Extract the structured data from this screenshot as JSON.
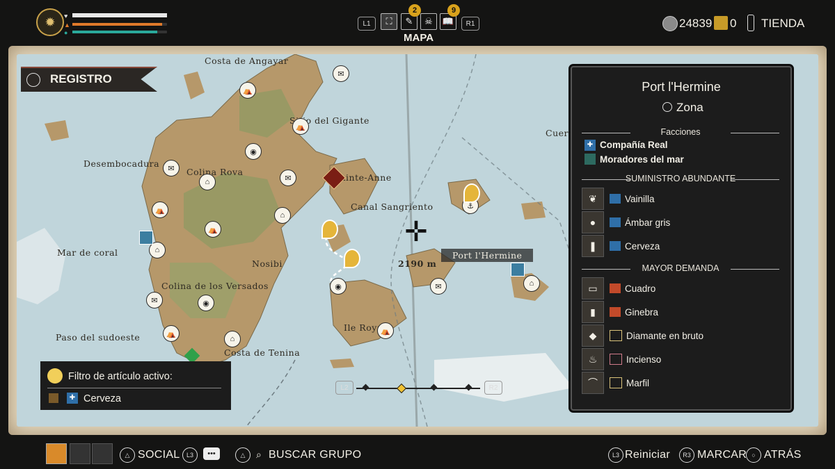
{
  "hud": {
    "mapa_label": "MAPA",
    "l1": "L1",
    "r1": "R1",
    "badge_1": "2",
    "badge_2": "9",
    "silver": "24839",
    "gold": "0",
    "tienda": "TIENDA",
    "health_level": 1.0,
    "stamina_level": 0.95,
    "xp_level": 0.9
  },
  "registro": {
    "label": "REGISTRO"
  },
  "map": {
    "labels": {
      "costa_angayar": "Costa de Angayar",
      "sitio_gigante": "Sitio del Gigante",
      "desembocadura": "Desembocadura",
      "colina_rova": "Colina Rova",
      "sainte_anne": "Sainte-Anne",
      "canal_sangriento": "Canal Sangriento",
      "mar_coral": "Mar de coral",
      "nosibi": "Nosibi",
      "colina_versados": "Colina de los Versados",
      "paso_sudoeste": "Paso del sudoeste",
      "costa_tenina": "Costa de Tenina",
      "ile_royale": "Ile Royale",
      "port_hermine": "Port l'Hermine",
      "cuer": "Cuer",
      "distance": "2190 m"
    },
    "l2": "L2",
    "r2": "R2"
  },
  "filter": {
    "title": "Filtro de artículo activo:",
    "item": "Cerveza"
  },
  "panel": {
    "title": "Port l'Hermine",
    "zona": "Zona",
    "facciones_header": "Facciones",
    "factions": [
      "Compañía Real",
      "Moradores del mar"
    ],
    "supply_header": "SUMINISTRO ABUNDANTE",
    "supply": [
      "Vainilla",
      "Ámbar gris",
      "Cerveza"
    ],
    "demand_header": "MAYOR DEMANDA",
    "demand": [
      "Cuadro",
      "Ginebra",
      "Diamante en bruto",
      "Incienso",
      "Marfil"
    ]
  },
  "bottom": {
    "social": "SOCIAL",
    "buscar_grupo": "BUSCAR GRUPO",
    "reiniciar": "Reiniciar",
    "marcar": "MARCAR",
    "atras": "ATRÁS",
    "l3": "L3",
    "r3": "R3"
  },
  "colors": {
    "health": "#e8e8e8",
    "stamina": "#e07a2a",
    "xp": "#2aa89a",
    "sea": "#b9d0d6",
    "land": "#b89a6e",
    "gold": "#d9a21c"
  }
}
